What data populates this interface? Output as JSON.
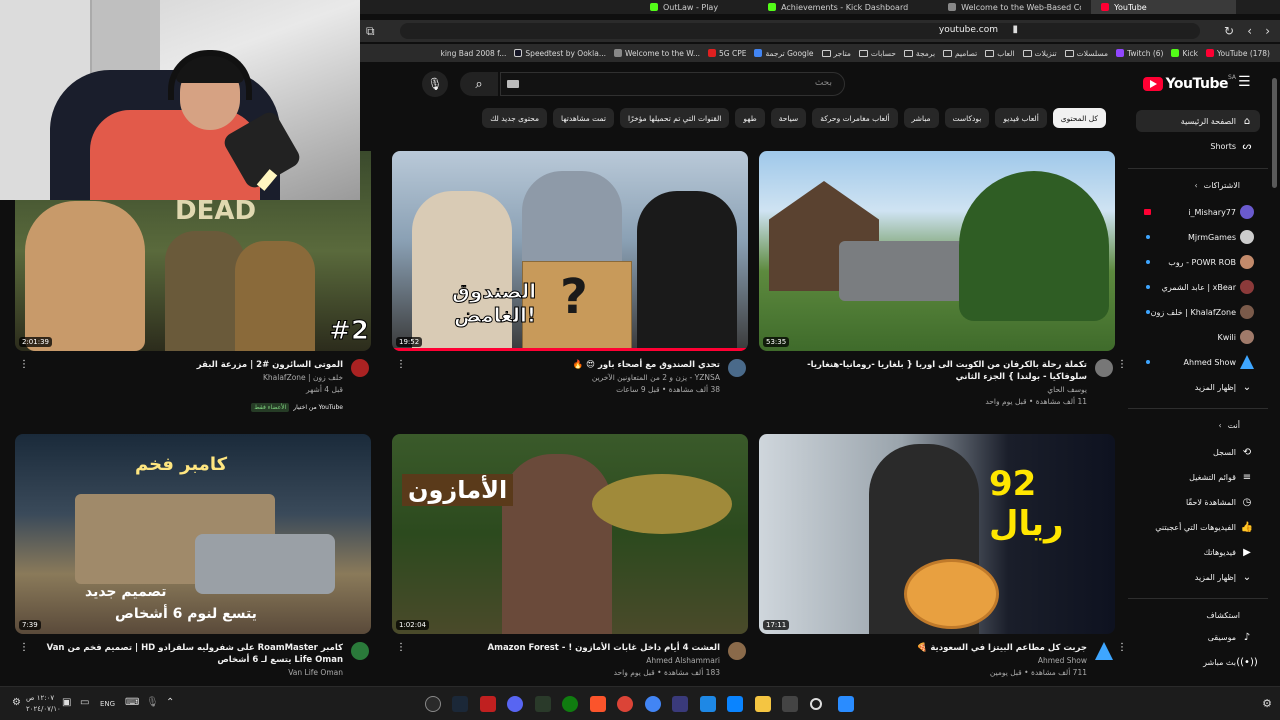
{
  "browser": {
    "tabs": [
      {
        "label": "OutLaw - Play",
        "color": "#53fc18"
      },
      {
        "label": "Achievements - Kick Dashboard",
        "color": "#53fc18"
      },
      {
        "label": "Welcome to the Web-Based Config",
        "color": "#888888"
      },
      {
        "label": "YouTube",
        "color": "#ff0033",
        "active": true
      }
    ],
    "url": "youtube.com",
    "bookmarks": [
      "YouTube (178)",
      "Kick",
      "Twitch (6)",
      "مسلسلات",
      "تنزيلات",
      "العاب",
      "تصاميم",
      "برمجة",
      "حسابات",
      "متاجر",
      "ترجمة Google",
      "5G CPE",
      "Welcome to the W...",
      "Speedtest by Ookla...",
      "king Bad 2008 f..."
    ]
  },
  "header": {
    "logo_text": "YouTube",
    "region": "SA",
    "search_placeholder": "بحث"
  },
  "chips": [
    "كل المحتوى",
    "ألعاب فيديو",
    "بودكاست",
    "مباشر",
    "ألعاب مغامرات وحركة",
    "سياحة",
    "طهو",
    "القنوات التي تم تحميلها مؤخرًا",
    "تمت مشاهدتها",
    "محتوى جديد لك"
  ],
  "sidebar": {
    "main": [
      {
        "label": "الصفحة الرئيسية",
        "icon": "home-icon"
      },
      {
        "label": "Shorts",
        "icon": "shorts-icon"
      }
    ],
    "subs_header": "الاشتراكات",
    "subscriptions": [
      {
        "label": "i_Mishary77",
        "color": "#6a5acd",
        "live": true
      },
      {
        "label": "MjrmGames",
        "color": "#cccccc",
        "dot": true
      },
      {
        "label": "روب - POWR ROB",
        "color": "#c28a6b",
        "dot": true
      },
      {
        "label": "عابد الشمري | xBear",
        "color": "#8b3a3a",
        "dot": true
      },
      {
        "label": "خلف زون | KhalafZone",
        "color": "#7a5a4a",
        "dot": true
      },
      {
        "label": "Kwili",
        "color": "#a07a6a"
      },
      {
        "label": "Ahmed Show",
        "color": "#3ea6ff",
        "dot": true
      }
    ],
    "show_more": "إظهار المزيد",
    "you_header": "أنت",
    "you_items": [
      {
        "label": "السجل",
        "icon": "history-icon"
      },
      {
        "label": "قوائم التشغيل",
        "icon": "playlist-icon"
      },
      {
        "label": "المشاهدة لاحقًا",
        "icon": "clock-icon"
      },
      {
        "label": "الفيديوهات التي أعجبتني",
        "icon": "like-icon"
      },
      {
        "label": "فيديوهاتك",
        "icon": "video-icon"
      },
      {
        "label": "إظهار المزيد",
        "icon": "chevron-down-icon"
      }
    ],
    "explore_header": "استكشاف",
    "explore_items": [
      {
        "label": "موسيقى",
        "icon": "music-icon"
      },
      {
        "label": "بث مباشر",
        "icon": "live-icon"
      }
    ]
  },
  "videos": [
    {
      "title": "تكملة رحلة بالكرفان من الكويت الى اوربا { بلغاريا -رومانيا-هنغاريا- سلوفاكيا - بولندا } الجزء الثاني",
      "channel": "يوسف الحاي",
      "stats": "11 ألف مشاهدة • قبل يوم واحد",
      "duration": "53:35",
      "avatar_color": "#777777"
    },
    {
      "title": "تحدي الصندوق مع أصحاء باور 😍 🔥",
      "channel": "YZNSA - يزن و 2 من المتعاونين الآخرين",
      "stats": "38 ألف مشاهدة • قبل 9 ساعات",
      "duration": "19:52",
      "avatar_color": "#4a6a8a",
      "thumb_text_1": "الصندوق",
      "thumb_text_2": "الغامض!"
    },
    {
      "title": "الموتى السائرون #2 | مزرعة البقر",
      "channel": "خلف زون | KhalafZone",
      "stats": "قبل 4 أشهر",
      "duration": "2:01:39",
      "avatar_color": "#aa2222",
      "thumb_text_1": "DEAD",
      "thumb_text_2": "#2",
      "badge_new": "الأعضاء فقط",
      "badge_from": "من اختيار YouTube"
    },
    {
      "title": "جربت كل مطاعم البيتزا في السعودية 🍕",
      "channel": "Ahmed Show",
      "stats": "711 ألف مشاهدة • قبل يومين",
      "duration": "17:11",
      "avatar_color": "#3ea6ff",
      "thumb_text_1": "92 ريال"
    },
    {
      "title": "العشت 4 أيام داخل غابات الأمازون ! - Amazon Forest",
      "channel": "Ahmed Alshammari",
      "stats": "183 ألف مشاهدة • قبل يوم واحد",
      "duration": "1:02:04",
      "avatar_color": "#8a6a4a",
      "thumb_text_1": "الأمازون"
    },
    {
      "title": "كامبر RoamMaster على شفروليه سلفرادو HD | تصميم فخم من Van Life Oman يتسع لـ 6 أشخاص",
      "channel": "Van Life Oman",
      "stats": "",
      "duration": "7:39",
      "avatar_color": "#2a7a3a",
      "thumb_text_1": "كامبر فخم",
      "thumb_text_2": "تصميم جديد",
      "thumb_text_3": "يتسع لنوم 6 أشخاص"
    }
  ],
  "taskbar": {
    "time": "١٢:٠٧ ص",
    "date": "٢٠٢٤/٠٧/١٠",
    "lang": "ENG"
  }
}
